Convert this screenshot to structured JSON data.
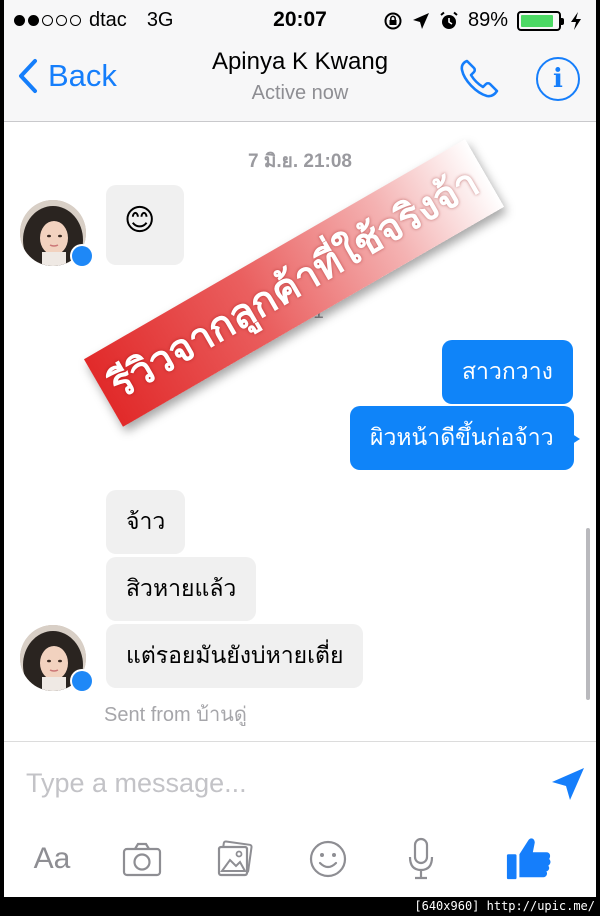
{
  "status_bar": {
    "carrier": "dtac",
    "network": "3G",
    "time": "20:07",
    "battery": "89%",
    "battery_level": 0.89
  },
  "nav": {
    "back_label": "Back",
    "title": "Apinya K Kwang",
    "subtitle": "Active now"
  },
  "messages": {
    "timestamp_1": "7 มิ.ย. 21:08",
    "timestamp_2": "20:01",
    "incoming_1": "😊",
    "outgoing_1": "สาวกวาง",
    "outgoing_2": "ผิวหน้าดีขึ้นก่อจ้าว",
    "incoming_2": "จ้าว",
    "incoming_3": "สิวหายแล้ว",
    "incoming_4": "แต่รอยมันยังบ่หายเตี่ย",
    "sent_from": "Sent from บ้านดู่"
  },
  "watermark": "รีวิวจากลูกค้าที่ใช้จริงจ้า",
  "composer": {
    "placeholder": "Type a message...",
    "aa_label": "Aa"
  },
  "corner_tag": "[640x960] http://upic.me/",
  "colors": {
    "accent": "#157efb",
    "outgoing_bubble": "#0f84f9",
    "incoming_bubble": "#f0f0f0",
    "battery": "#4cd964"
  }
}
